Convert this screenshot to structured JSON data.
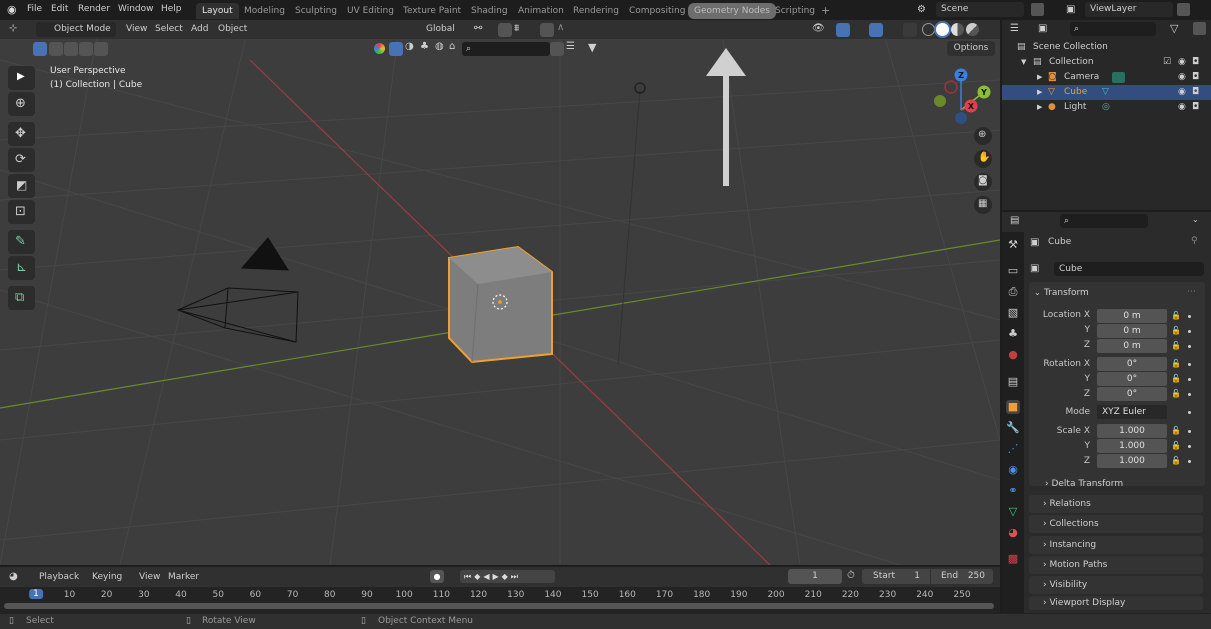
{
  "top_menu": {
    "items": [
      "File",
      "Edit",
      "Render",
      "Window",
      "Help"
    ]
  },
  "workspaces": {
    "tabs": [
      "Layout",
      "Modeling",
      "Sculpting",
      "UV Editing",
      "Texture Paint",
      "Shading",
      "Animation",
      "Rendering",
      "Compositing",
      "Geometry Nodes",
      "Scripting"
    ],
    "active": "Layout",
    "highlighted": "Geometry Nodes",
    "add": "+"
  },
  "scene": {
    "name": "Scene",
    "view_layer": "ViewLayer"
  },
  "viewport_header": {
    "mode": "Object Mode",
    "menus": [
      "View",
      "Select",
      "Add",
      "Object"
    ],
    "transform_orientation": "Global",
    "options": "Options"
  },
  "viewport": {
    "perspective": "User Perspective",
    "collection_info": "(1) Collection | Cube",
    "annotation": "arrow pointing up at Geometry Nodes tab"
  },
  "gizmo": {
    "x": "X",
    "y": "Y",
    "z": "Z"
  },
  "outliner": {
    "search_placeholder": "",
    "items": [
      {
        "name": "Scene Collection",
        "level": 0
      },
      {
        "name": "Collection",
        "level": 1
      },
      {
        "name": "Camera",
        "level": 2
      },
      {
        "name": "Cube",
        "level": 2,
        "selected": true
      },
      {
        "name": "Light",
        "level": 2
      }
    ]
  },
  "properties": {
    "object_name": "Cube",
    "datablock": "Cube",
    "transform": {
      "title": "Transform",
      "location": {
        "label": "Location X",
        "x": "0 m",
        "y": "0 m",
        "z": "0 m"
      },
      "rotation": {
        "label": "Rotation X",
        "x": "0°",
        "y": "0°",
        "z": "0°"
      },
      "mode_label": "Mode",
      "mode": "XYZ Euler",
      "scale": {
        "label": "Scale X",
        "x": "1.000",
        "y": "1.000",
        "z": "1.000"
      },
      "y": "Y",
      "z": "Z",
      "delta": "Delta Transform"
    },
    "panels": [
      "Relations",
      "Collections",
      "Instancing",
      "Motion Paths",
      "Visibility",
      "Viewport Display"
    ]
  },
  "timeline": {
    "menus": [
      "Playback",
      "Keying",
      "View",
      "Marker"
    ],
    "current_frame": "1",
    "start_label": "Start",
    "start": "1",
    "end_label": "End",
    "end": "250",
    "ticks": [
      "1",
      "10",
      "20",
      "30",
      "40",
      "50",
      "60",
      "70",
      "80",
      "90",
      "100",
      "110",
      "120",
      "130",
      "140",
      "150",
      "160",
      "170",
      "180",
      "190",
      "200",
      "210",
      "220",
      "230",
      "240",
      "250"
    ]
  },
  "statusbar": {
    "select": "Select",
    "rotate": "Rotate View",
    "context": "Object Context Menu"
  },
  "colors": {
    "accent": "#4772b3",
    "selection": "#f0a030",
    "x_axis": "#e0404a",
    "y_axis": "#8ac030",
    "z_axis": "#3a80e0"
  }
}
